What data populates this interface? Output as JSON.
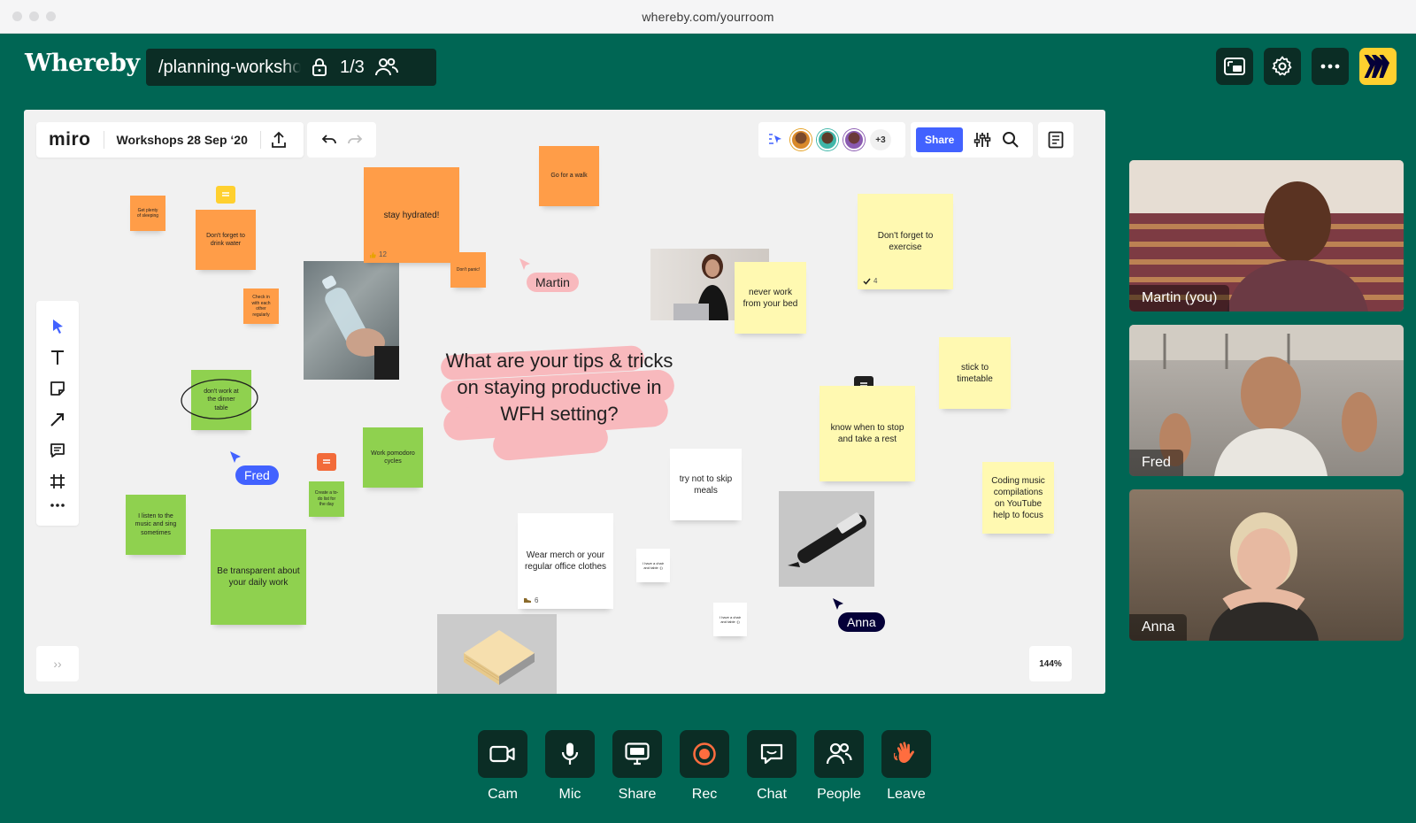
{
  "browser": {
    "url": "whereby.com/yourroom"
  },
  "header": {
    "logo": "Whereby",
    "room_name": "/planning-workshop",
    "participant_count": "1/3"
  },
  "miro": {
    "logo": "miro",
    "board_title": "Workshops 28 Sep ‘20",
    "collaborators_more": "+3",
    "share_label": "Share",
    "zoom": "144%",
    "expand_label": "››"
  },
  "stickies": {
    "s1": "Get plenty of sleeping",
    "s2": "Don't forget to drink water",
    "s3": "Check in with each other regularly",
    "s4": "stay hydrated!",
    "s4_votes": "12",
    "s5": "Don't panic!",
    "s6": "Go for a walk",
    "s7": "never work from your bed",
    "s8": "Don't forget to exercise",
    "s8_votes": "4",
    "s9": "stick to timetable",
    "s10": "know when to stop and take a rest",
    "s11": "Coding music compilations on YouTube help to focus",
    "s12": "don't work at the dinner table",
    "s13": "Work pomodoro cycles",
    "s14": "Create a to-do list for the day",
    "s15": "I listen to the music and sing sometimes",
    "s16": "Be transparent about your daily work",
    "s17": "try not to skip meals",
    "s18": "Wear merch or your regular office clothes",
    "s18_votes": "6",
    "s19": "I have a chair and table :))",
    "s20": "I have a chair and table :))"
  },
  "question": "What are your tips & tricks on staying productive in WFH setting?",
  "cursors": {
    "martin": "Martin",
    "fred": "Fred",
    "anna": "Anna"
  },
  "participants": [
    {
      "name": "Martin (you)"
    },
    {
      "name": "Fred"
    },
    {
      "name": "Anna"
    }
  ],
  "controls": {
    "cam": "Cam",
    "mic": "Mic",
    "share": "Share",
    "rec": "Rec",
    "chat": "Chat",
    "people": "People",
    "leave": "Leave"
  },
  "colors": {
    "brand": "#006654",
    "dark_button": "#0b2d25",
    "miro_yellow": "#ffd02f",
    "miro_blue": "#4262ff",
    "rec_orange": "#ff6d3f"
  }
}
